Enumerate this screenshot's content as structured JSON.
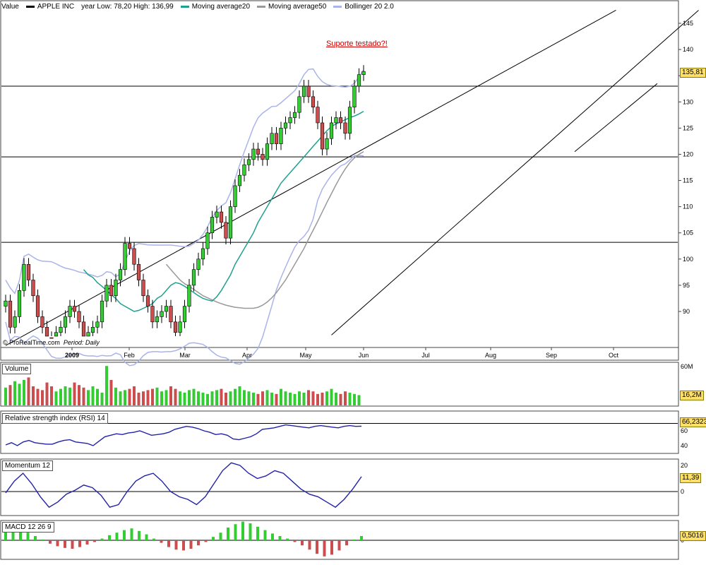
{
  "legend": {
    "value_label": "Value",
    "ticker_label": "APPLE INC",
    "range_label": "year Low: 78,20 High: 136,99",
    "ma20_label": "Moving average20",
    "ma50_label": "Moving average50",
    "bollinger_label": "Bollinger 20 2.0"
  },
  "colors": {
    "up": "#33cc33",
    "down": "#cc4d4d",
    "ma20": "#20a090",
    "ma50": "#999999",
    "bollinger": "#aab4e8",
    "indicator": "#2222aa",
    "price_tag": "#ffe066",
    "annotation": "#cc0000"
  },
  "footer": {
    "copyright": "© ProRealTime.com",
    "period": "Period: Daily"
  },
  "annotation": "Suporte testado?!",
  "panels": {
    "volume": {
      "label": "Volume",
      "axis_top": "60M",
      "last": "16,2M"
    },
    "rsi": {
      "label": "Relative strength index (RSI) 14",
      "axis_labels": [
        "60",
        "40"
      ],
      "last": "66,2323"
    },
    "momentum": {
      "label": "Momentum 12",
      "axis_labels": [
        "20",
        "10",
        "0"
      ],
      "last": "11,39"
    },
    "macd": {
      "label": "MACD 12 26 9",
      "axis_labels": [
        "0"
      ],
      "last": "0,5016"
    }
  },
  "chart_data": {
    "type": "candlestick",
    "title": "APPLE INC",
    "price_last": "135,81",
    "y_ticks": [
      90,
      95,
      100,
      105,
      110,
      115,
      120,
      125,
      130,
      135,
      140,
      145
    ],
    "ylim": [
      85,
      147.5
    ],
    "x_labels": [
      "2009",
      "Feb",
      "Mar",
      "Apr",
      "May",
      "Jun",
      "Jul",
      "Aug",
      "Sep",
      "Oct"
    ],
    "horizontal_levels": [
      133.0,
      119.5,
      103.2
    ],
    "channel_lines": [
      {
        "from": [
          0,
          83.5
        ],
        "to": [
          133,
          147.5
        ]
      },
      {
        "from": [
          71,
          85.5
        ],
        "to": [
          151,
          147.5
        ]
      },
      {
        "from": [
          124,
          120.5
        ],
        "to": [
          142,
          133.5
        ]
      }
    ],
    "closes": [
      92,
      87,
      89,
      94,
      99,
      96,
      93,
      89,
      87,
      85,
      84,
      86,
      87,
      89,
      91,
      90,
      88,
      85,
      86,
      87,
      88,
      92,
      95,
      93,
      96,
      98,
      103,
      102,
      99,
      96,
      93,
      91,
      88,
      89,
      90,
      91,
      88,
      86,
      88,
      91,
      95,
      98,
      100,
      102,
      105,
      108,
      109,
      107,
      104,
      110,
      114,
      116,
      118,
      119,
      121,
      120,
      119,
      122,
      124,
      122,
      125,
      126,
      127,
      128,
      131,
      133,
      131,
      129,
      126,
      121,
      123,
      126,
      127,
      126,
      124,
      129,
      133,
      135.2,
      135.81
    ],
    "ma20": [
      98,
      97,
      96.5,
      95.5,
      94.8,
      94,
      93.2,
      92.5,
      91.5,
      91,
      90.5,
      90,
      90.2,
      90.6,
      91,
      91.5,
      92.5,
      93,
      94,
      95,
      95.5,
      95.3,
      94.8,
      94.2,
      93.6,
      93,
      92.5,
      92.2,
      92,
      92.8,
      94,
      95.5,
      97,
      99,
      100.5,
      102,
      103.5,
      105,
      107,
      108.5,
      110,
      111.5,
      113,
      114.5,
      115.5,
      116.5,
      117.5,
      118.5,
      119.5,
      120.5,
      121.5,
      122.5,
      123.5,
      124.5,
      125.3,
      125.8,
      126.2,
      126.6,
      127,
      127.3,
      127.7,
      128.2
    ],
    "ma50": [
      99,
      98,
      97,
      96,
      95.3,
      94.8,
      94.2,
      93.6,
      93,
      92.6,
      92.2,
      91.8,
      91.5,
      91.2,
      91,
      90.8,
      90.7,
      90.6,
      90.6,
      90.6,
      90.8,
      91.2,
      91.8,
      92.6,
      93.6,
      94.8,
      96,
      97.5,
      99,
      100.5,
      102,
      103.8,
      105.5,
      107.2,
      109,
      110.8,
      112.5,
      114.2,
      115.8,
      117.2,
      118.4,
      119.3,
      120,
      120.5
    ],
    "volume": [
      28,
      32,
      38,
      34,
      40,
      44,
      30,
      26,
      24,
      36,
      30,
      22,
      26,
      30,
      28,
      36,
      32,
      28,
      24,
      30,
      26,
      20,
      62,
      40,
      28,
      22,
      24,
      26,
      30,
      20,
      22,
      24,
      26,
      28,
      22,
      24,
      30,
      26,
      22,
      20,
      24,
      26,
      22,
      20,
      18,
      22,
      24,
      26,
      20,
      22,
      26,
      30,
      24,
      22,
      20,
      18,
      22,
      24,
      20,
      18,
      26,
      22,
      20,
      18,
      22,
      20,
      24,
      22,
      18,
      20,
      22,
      26,
      20,
      18,
      22,
      20,
      18,
      16.2
    ],
    "rsi": [
      41,
      44,
      40,
      45,
      47,
      44,
      43,
      42,
      42,
      45,
      47,
      48,
      45,
      44,
      43,
      40,
      46,
      52,
      54,
      56,
      55,
      57,
      58,
      60,
      57,
      54,
      55,
      56,
      58,
      62,
      64,
      66,
      65,
      63,
      60,
      58,
      55,
      56,
      54,
      49,
      48,
      50,
      52,
      56,
      62,
      63,
      64,
      66,
      68,
      67,
      66,
      65,
      64,
      66,
      67,
      66,
      65,
      64,
      66,
      67,
      66,
      66.23
    ],
    "momentum": [
      -1,
      8,
      14,
      6,
      -4,
      -12,
      -8,
      -2,
      1,
      5,
      3,
      -3,
      -12,
      -10,
      0,
      8,
      12,
      14,
      8,
      0,
      -4,
      -6,
      -10,
      -4,
      6,
      16,
      22,
      20,
      14,
      10,
      12,
      16,
      14,
      8,
      2,
      -2,
      -4,
      -8,
      -12,
      -6,
      2,
      11.39
    ],
    "macd": [
      1.5,
      1.4,
      1.2,
      0.9,
      0.5,
      0.1,
      -0.4,
      -0.7,
      -0.9,
      -1.0,
      -0.8,
      -0.5,
      -0.2,
      0.2,
      0.6,
      0.9,
      1.2,
      1.4,
      1.1,
      0.7,
      0.2,
      -0.3,
      -0.8,
      -1.1,
      -1.2,
      -1.0,
      -0.6,
      -0.2,
      0.4,
      0.9,
      1.5,
      1.9,
      2.2,
      2.0,
      1.6,
      1.2,
      0.8,
      0.5,
      0.2,
      -0.2,
      -0.6,
      -1.1,
      -1.6,
      -1.9,
      -1.7,
      -1.2,
      -0.6,
      0.1,
      0.5016
    ]
  }
}
